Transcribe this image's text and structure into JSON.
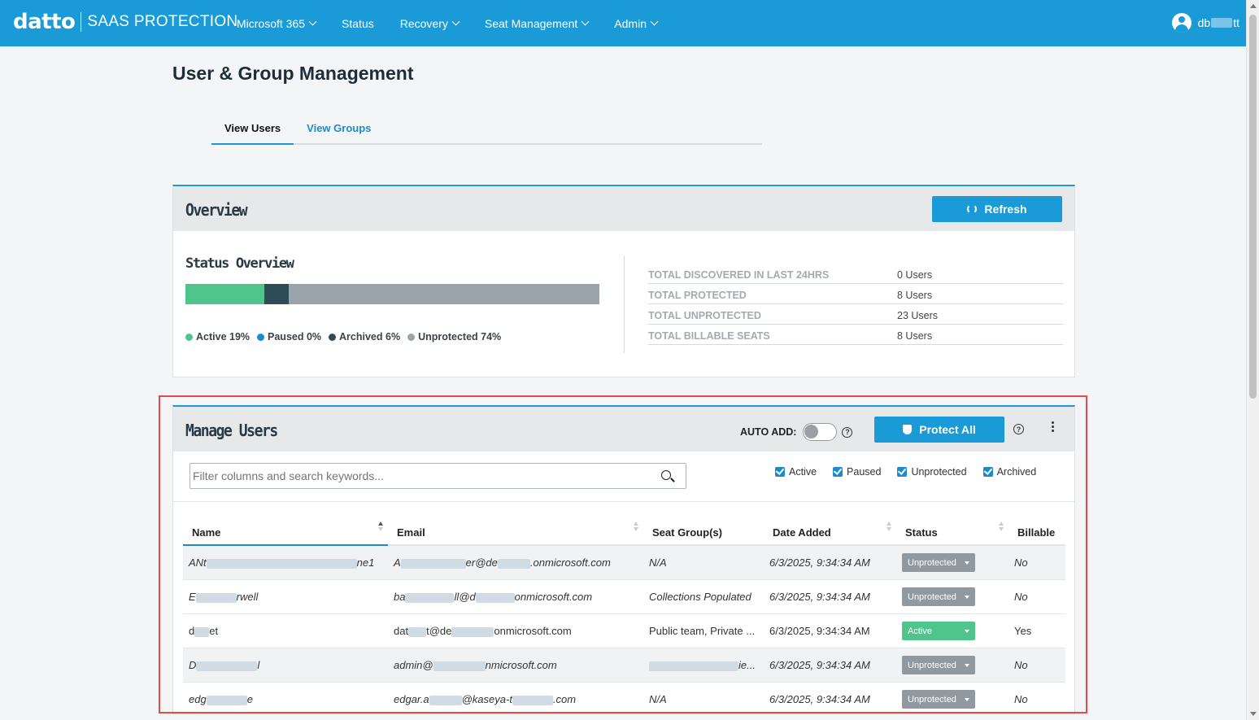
{
  "header": {
    "logo": "datto",
    "product": "SAAS PROTECTION",
    "nav": [
      {
        "label": "Microsoft 365",
        "dropdown": true
      },
      {
        "label": "Status",
        "dropdown": false
      },
      {
        "label": "Recovery",
        "dropdown": true
      },
      {
        "label": "Seat Management",
        "dropdown": true
      },
      {
        "label": "Admin",
        "dropdown": true
      }
    ],
    "user_prefix": "db",
    "user_suffix": "tt"
  },
  "page": {
    "title": "User & Group Management",
    "tabs": [
      {
        "label": "View Users",
        "active": true
      },
      {
        "label": "View Groups",
        "active": false
      }
    ]
  },
  "overview": {
    "title": "Overview",
    "refresh_label": "Refresh",
    "status_title": "Status Overview",
    "segments": [
      {
        "name": "Active",
        "percent": 19,
        "color": "#4fc58d"
      },
      {
        "name": "Paused",
        "percent": 0,
        "color": "#1a8ccc"
      },
      {
        "name": "Archived",
        "percent": 6,
        "color": "#2f4b58"
      },
      {
        "name": "Unprotected",
        "percent": 74,
        "color": "#9aa4ab"
      }
    ],
    "legend": [
      {
        "label": "Active 19%",
        "color": "#4fc58d"
      },
      {
        "label": "Paused 0%",
        "color": "#1a8ccc"
      },
      {
        "label": "Archived 6%",
        "color": "#2f4b58"
      },
      {
        "label": "Unprotected 74%",
        "color": "#9aa4ab"
      }
    ],
    "stats": [
      {
        "label": "TOTAL DISCOVERED IN LAST 24HRS",
        "value": "0 Users"
      },
      {
        "label": "TOTAL PROTECTED",
        "value": "8 Users"
      },
      {
        "label": "TOTAL UNPROTECTED",
        "value": "23 Users"
      },
      {
        "label": "TOTAL BILLABLE SEATS",
        "value": "8 Users"
      }
    ]
  },
  "manage": {
    "title": "Manage Users",
    "auto_add_label": "AUTO ADD:",
    "protect_all_label": "Protect All",
    "search_placeholder": "Filter columns and search keywords...",
    "filters": [
      "Active",
      "Paused",
      "Unprotected",
      "Archived"
    ],
    "columns": [
      "Name",
      "Email",
      "Seat Group(s)",
      "Date Added",
      "Status",
      "Billable"
    ],
    "rows": [
      {
        "name_a": "ANt",
        "name_b": "ne1",
        "email_a": "A",
        "email_b": "er@de",
        "email_c": ".onmicrosoft.com",
        "seat": "N/A",
        "date": "6/3/2025, 9:34:34 AM",
        "status": "Unprotected",
        "billable": "No",
        "italic": true
      },
      {
        "name_a": "E",
        "name_b": "rwell",
        "email_a": "ba",
        "email_b": "ll@d",
        "email_c": "onmicrosoft.com",
        "seat": "Collections Populated",
        "date": "6/3/2025, 9:34:34 AM",
        "status": "Unprotected",
        "billable": "No",
        "italic": true
      },
      {
        "name_a": "d",
        "name_b": "et",
        "email_a": "dat",
        "email_b": "t@de",
        "email_c": "onmicrosoft.com",
        "seat": "Public team, Private ...",
        "date": "6/3/2025, 9:34:34 AM",
        "status": "Active",
        "billable": "Yes",
        "italic": false
      },
      {
        "name_a": "D",
        "name_b": "l",
        "email_a": "admin@",
        "email_b": "",
        "email_c": "nmicrosoft.com",
        "seat": "ie...",
        "date": "6/3/2025, 9:34:34 AM",
        "status": "Unprotected",
        "billable": "No",
        "italic": true
      },
      {
        "name_a": "edg",
        "name_b": "e",
        "email_a": "edgar.a",
        "email_b": "@kaseya-t",
        "email_c": ".com",
        "seat": "N/A",
        "date": "6/3/2025, 9:34:34 AM",
        "status": "Unprotected",
        "billable": "No",
        "italic": true
      }
    ]
  }
}
